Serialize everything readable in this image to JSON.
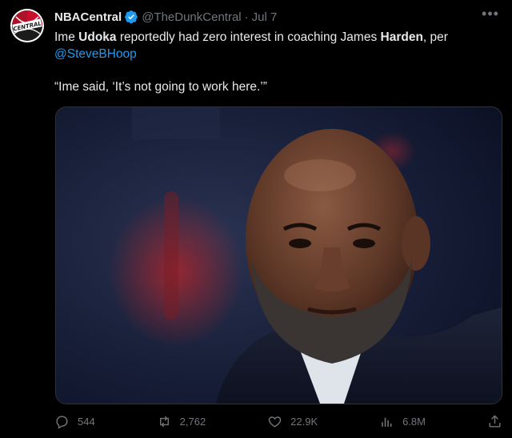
{
  "tweet": {
    "display_name": "NBACentral",
    "handle": "@TheDunkCentral",
    "separator": "·",
    "time": "Jul 7",
    "text": {
      "part1": "Ime ",
      "bold1": "Udoka",
      "part2": " reportedly had zero interest in coaching James ",
      "bold2": "Harden",
      "part3": ", per ",
      "mention": "@SteveBHoop"
    },
    "quote": "“Ime said, ‘It’s not going to work here.’”",
    "avatar_label": "CENTRAL"
  },
  "actions": {
    "replies": "544",
    "retweets": "2,762",
    "likes": "22.9K",
    "views": "6.8M"
  },
  "colors": {
    "background": "#000000",
    "text": "#e7e9ea",
    "muted": "#71767b",
    "link": "#1d9bf0",
    "verified": "#1d9bf0"
  },
  "icons": [
    "avatar-logo",
    "verified-badge-icon",
    "more-icon",
    "reply-icon",
    "retweet-icon",
    "like-icon",
    "views-icon",
    "share-icon"
  ]
}
